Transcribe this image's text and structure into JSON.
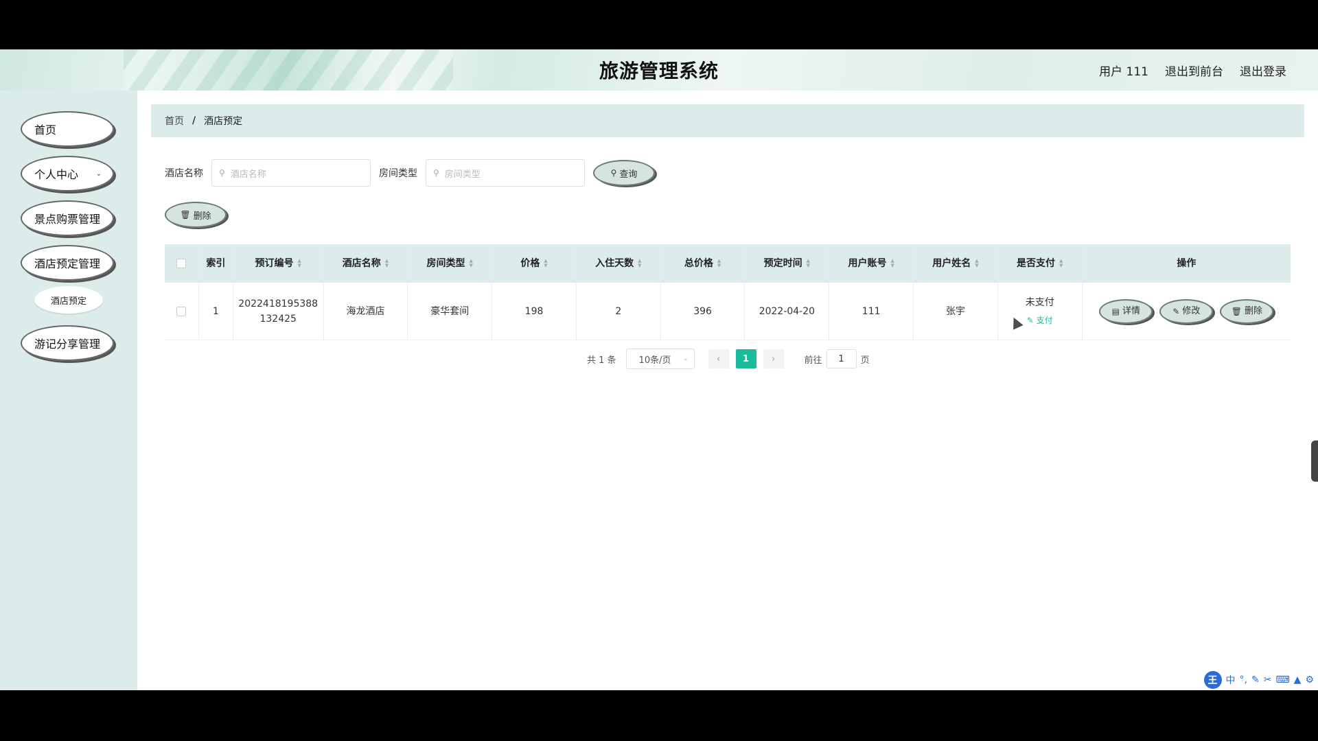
{
  "header": {
    "title": "旅游管理系统",
    "user": "用户 111",
    "to_front": "退出到前台",
    "logout": "退出登录"
  },
  "sidebar": {
    "items": [
      {
        "label": "首页"
      },
      {
        "label": "个人中心"
      },
      {
        "label": "景点购票管理"
      },
      {
        "label": "酒店预定管理"
      },
      {
        "label": "游记分享管理"
      }
    ],
    "sub_item": "酒店预定"
  },
  "breadcrumb": {
    "home": "首页",
    "sep": "/",
    "current": "酒店预定"
  },
  "search": {
    "hotel_label": "酒店名称",
    "hotel_placeholder": "酒店名称",
    "room_label": "房间类型",
    "room_placeholder": "房间类型",
    "query_button": "查询"
  },
  "toolbar": {
    "delete_button": "删除"
  },
  "table": {
    "headers": [
      "索引",
      "预订编号",
      "酒店名称",
      "房间类型",
      "价格",
      "入住天数",
      "总价格",
      "预定时间",
      "用户账号",
      "用户姓名",
      "是否支付",
      "操作"
    ],
    "rows": [
      {
        "index": "1",
        "order_no_1": "2022418195388",
        "order_no_2": "132425",
        "hotel": "海龙酒店",
        "room": "豪华套间",
        "price": "198",
        "days": "2",
        "total": "396",
        "date": "2022-04-20",
        "account": "111",
        "name": "张宇",
        "paid": "未支付",
        "pay_action": "支付",
        "detail": "详情",
        "edit": "修改",
        "delete": "删除"
      }
    ]
  },
  "pagination": {
    "total": "共 1 条",
    "page_size": "10条/页",
    "current": "1",
    "goto_label": "前往",
    "goto_value": "1",
    "page_unit": "页"
  },
  "ime": {
    "logo": "王",
    "lang": "中"
  },
  "icons": {
    "search": "search-icon",
    "trash": "trash-icon",
    "detail": "document-icon",
    "edit": "pencil-icon",
    "chevron": "chevron-down-icon"
  }
}
